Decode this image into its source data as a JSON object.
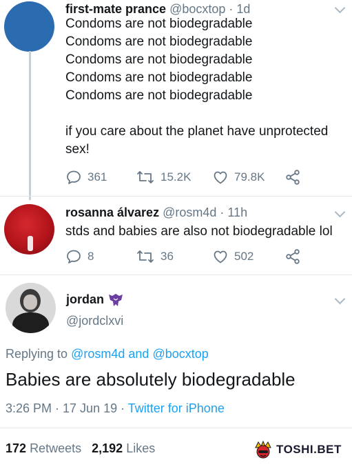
{
  "tweet1": {
    "name": "first-mate prance",
    "handle": "@bocxtop",
    "time": "· 1d",
    "lines": [
      "Condoms are not biodegradable",
      "Condoms are not biodegradable",
      "Condoms are not biodegradable",
      "Condoms are not biodegradable",
      "Condoms are not biodegradable"
    ],
    "para2_line1": "if you care about the planet have unprotected",
    "para2_line2": "sex!",
    "replies": "361",
    "retweets": "15.2K",
    "likes": "79.8K"
  },
  "tweet2": {
    "name": "rosanna álvarez",
    "handle": "@rosm4d",
    "time": "· 11h",
    "text": "stds and babies are also not biodegradable lol",
    "replies": "8",
    "retweets": "36",
    "likes": "502"
  },
  "tweet3": {
    "name": "jordan",
    "handle": "@jordclxvi",
    "replying_prefix": "Replying to",
    "replying_user1": "@rosm4d",
    "replying_and": "and",
    "replying_user2": "@bocxtop",
    "text": "Babies are absolutely biodegradable",
    "time": "3:26 PM · 17 Jun 19 ·",
    "client": "Twitter for iPhone",
    "retweet_count": "172",
    "retweet_label": "Retweets",
    "like_count": "2,192",
    "like_label": "Likes"
  },
  "watermark": {
    "text": "TOSHI.BET"
  },
  "colors": {
    "link": "#1da1f2",
    "muted": "#657786",
    "avatar1": "#2b6cb0",
    "avatar2": "#b3141b"
  },
  "icons": [
    "reply-icon",
    "retweet-icon",
    "like-icon",
    "share-icon",
    "chevron-down-icon",
    "decepticon-icon"
  ]
}
